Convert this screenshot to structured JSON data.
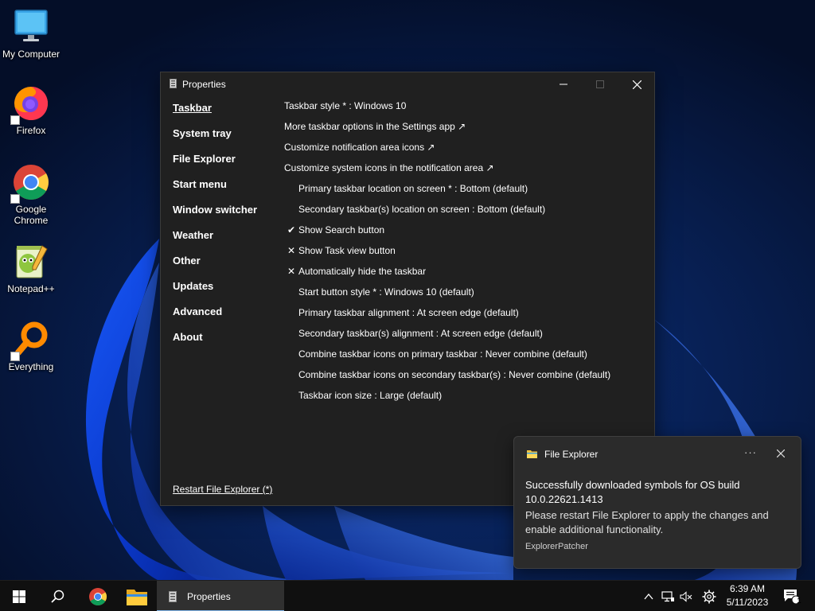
{
  "desktop": {
    "icons": [
      {
        "label": "My Computer",
        "icon": "monitor-icon"
      },
      {
        "label": "Firefox",
        "icon": "firefox-icon"
      },
      {
        "label": "Google Chrome",
        "icon": "chrome-icon"
      },
      {
        "label": "Notepad++",
        "icon": "notepadpp-icon"
      },
      {
        "label": "Everything",
        "icon": "search-magnifier-icon"
      }
    ]
  },
  "window": {
    "title": "Properties",
    "nav": [
      {
        "label": "Taskbar",
        "active": true
      },
      {
        "label": "System tray"
      },
      {
        "label": "File Explorer"
      },
      {
        "label": "Start menu"
      },
      {
        "label": "Window switcher"
      },
      {
        "label": "Weather"
      },
      {
        "label": "Other"
      },
      {
        "label": "Updates"
      },
      {
        "label": "Advanced"
      },
      {
        "label": "About"
      }
    ],
    "settings": [
      {
        "text": "Taskbar style * : Windows 10",
        "mark": ""
      },
      {
        "text": "More taskbar options in the Settings app ↗",
        "mark": ""
      },
      {
        "text": "Customize notification area icons ↗",
        "mark": ""
      },
      {
        "text": "Customize system icons in the notification area ↗",
        "mark": ""
      },
      {
        "text": "Primary taskbar location on screen * : Bottom (default)",
        "mark": "indent"
      },
      {
        "text": "Secondary taskbar(s) location on screen : Bottom (default)",
        "mark": "indent"
      },
      {
        "text": "Show Search button",
        "mark": "✔"
      },
      {
        "text": "Show Task view button",
        "mark": "✕"
      },
      {
        "text": "Automatically hide the taskbar",
        "mark": "✕"
      },
      {
        "text": "Start button style * : Windows 10 (default)",
        "mark": "indent"
      },
      {
        "text": "Primary taskbar alignment : At screen edge (default)",
        "mark": "indent"
      },
      {
        "text": "Secondary taskbar(s) alignment : At screen edge (default)",
        "mark": "indent"
      },
      {
        "text": "Combine taskbar icons on primary taskbar : Never combine (default)",
        "mark": "indent"
      },
      {
        "text": "Combine taskbar icons on secondary taskbar(s) : Never combine (default)",
        "mark": "indent"
      },
      {
        "text": "Taskbar icon size : Large (default)",
        "mark": "indent"
      }
    ],
    "restart_link": "Restart File Explorer (*)"
  },
  "toast": {
    "app": "File Explorer",
    "more": "···",
    "title": "Successfully downloaded symbols for OS build 10.0.22621.1413",
    "body": "Please restart File Explorer to apply the changes and enable additional functionality.",
    "source": "ExplorerPatcher"
  },
  "taskbar": {
    "window_label": "Properties",
    "time": "6:39 AM",
    "date": "5/11/2023",
    "notification_count": "1"
  }
}
